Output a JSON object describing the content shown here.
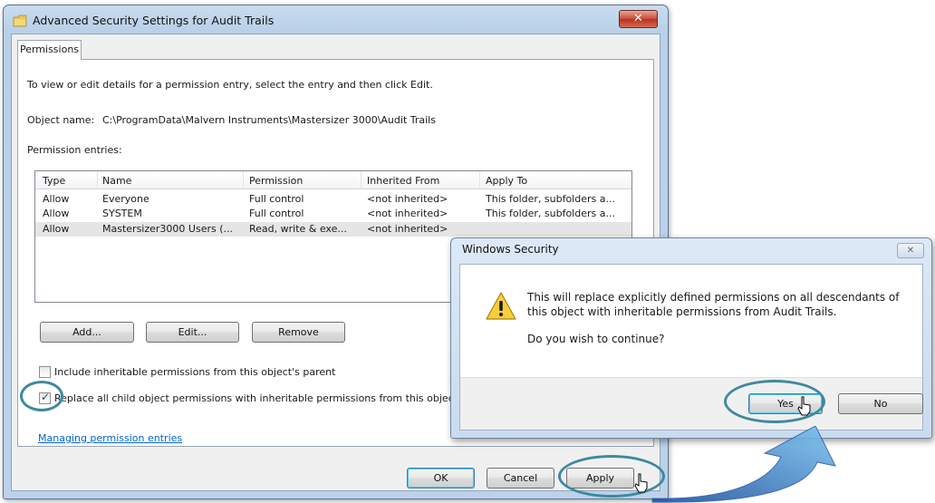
{
  "window": {
    "title": "Advanced Security Settings for Audit Trails",
    "close_glyph": "✕",
    "tab": "Permissions",
    "instruction": "To view or edit details for a permission entry, select the entry and then click Edit.",
    "object_name_label": "Object name:",
    "object_name_value": "C:\\ProgramData\\Malvern Instruments\\Mastersizer 3000\\Audit Trails",
    "entries_label": "Permission entries:",
    "columns": [
      "Type",
      "Name",
      "Permission",
      "Inherited From",
      "Apply To"
    ],
    "rows": [
      {
        "type": "Allow",
        "name": "Everyone",
        "permission": "Full control",
        "inherited": "<not inherited>",
        "apply": "This folder, subfolders a..."
      },
      {
        "type": "Allow",
        "name": "SYSTEM",
        "permission": "Full control",
        "inherited": "<not inherited>",
        "apply": "This folder, subfolders a..."
      },
      {
        "type": "Allow",
        "name": "Mastersizer3000 Users (...",
        "permission": "Read, write & exe...",
        "inherited": "<not inherited>",
        "apply": ""
      }
    ],
    "add_button": "Add...",
    "edit_button": "Edit...",
    "remove_button": "Remove",
    "include_inheritable": "Include inheritable permissions from this object's parent",
    "include_checked": false,
    "replace_child": "Replace all child object permissions with inheritable permissions from this object",
    "replace_checked": true,
    "managing_link": "Managing permission entries",
    "ok_button": "OK",
    "cancel_button": "Cancel",
    "apply_button": "Apply"
  },
  "dialog": {
    "title": "Windows Security",
    "close_glyph": "✕",
    "message_line1": "This will replace explicitly defined permissions on all descendants of",
    "message_line2": "this object with inheritable permissions from Audit Trails.",
    "question": "Do you wish to continue?",
    "yes_button": "Yes",
    "no_button": "No"
  },
  "colors": {
    "highlight_ring": "#3e8a9e",
    "arrow": "#3d82c9",
    "link": "#0066cc"
  }
}
